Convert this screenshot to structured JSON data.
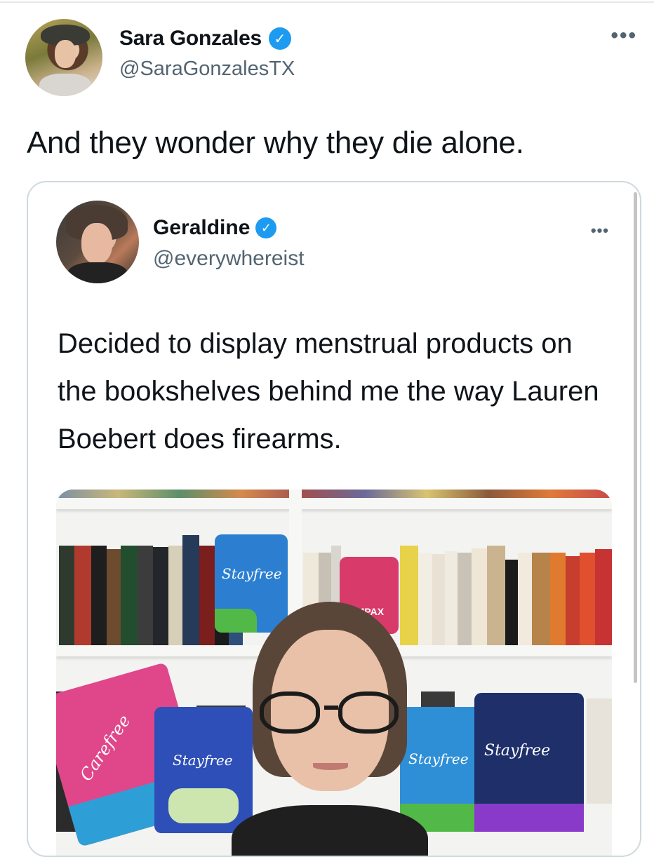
{
  "tweet": {
    "author_name": "Sara Gonzales",
    "author_handle": "@SaraGonzalesTX",
    "text": "And they wonder why they die alone.",
    "verified_glyph": "✓",
    "more_glyph": "•••"
  },
  "quoted_tweet": {
    "author_name": "Geraldine",
    "author_handle": "@everywhereist",
    "text": "Decided to display menstrual products on the bookshelves behind me the way Lauren Boebert does firearms.",
    "verified_glyph": "✓",
    "more_glyph": "•••",
    "photo": {
      "labels": [
        "Stayfree",
        "Carefree",
        "Stayfree",
        "Stayfree",
        "Stayfree",
        "TAMPAX"
      ]
    }
  },
  "colors": {
    "verified_blue": "#1d9bf0",
    "secondary_text": "#536471",
    "border": "#cfd9de"
  },
  "icons": [
    "verified-badge-icon",
    "more-options-icon"
  ]
}
